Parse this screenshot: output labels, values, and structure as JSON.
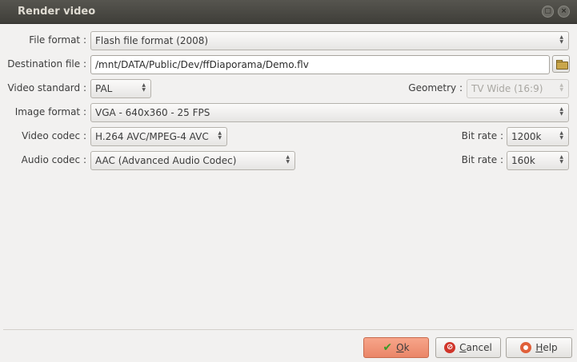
{
  "window": {
    "title": "Render video",
    "maximize_glyph": "▢",
    "close_glyph": "×"
  },
  "form": {
    "file_format": {
      "label": "File format :",
      "value": "Flash file format (2008)"
    },
    "destination": {
      "label": "Destination file :",
      "value": "/mnt/DATA/Public/Dev/ffDiaporama/Demo.flv",
      "browse_icon": "folder-open-icon"
    },
    "video_standard": {
      "label": "Video standard :",
      "value": "PAL"
    },
    "geometry": {
      "label": "Geometry :",
      "value": "TV Wide (16:9)",
      "disabled": true
    },
    "image_format": {
      "label": "Image format :",
      "value": "VGA - 640x360 - 25 FPS"
    },
    "video_codec": {
      "label": "Video codec :",
      "value": "H.264 AVC/MPEG-4 AVC"
    },
    "video_bitrate": {
      "label": "Bit rate :",
      "value": "1200k"
    },
    "audio_codec": {
      "label": "Audio codec :",
      "value": "AAC (Advanced Audio Codec)"
    },
    "audio_bitrate": {
      "label": "Bit rate :",
      "value": "160k"
    }
  },
  "buttons": {
    "ok": {
      "underline": "O",
      "rest": "k"
    },
    "cancel": {
      "underline": "C",
      "rest": "ancel"
    },
    "help": {
      "underline": "H",
      "rest": "elp"
    }
  },
  "arrow_glyphs": {
    "up": "▲",
    "down": "▼"
  }
}
